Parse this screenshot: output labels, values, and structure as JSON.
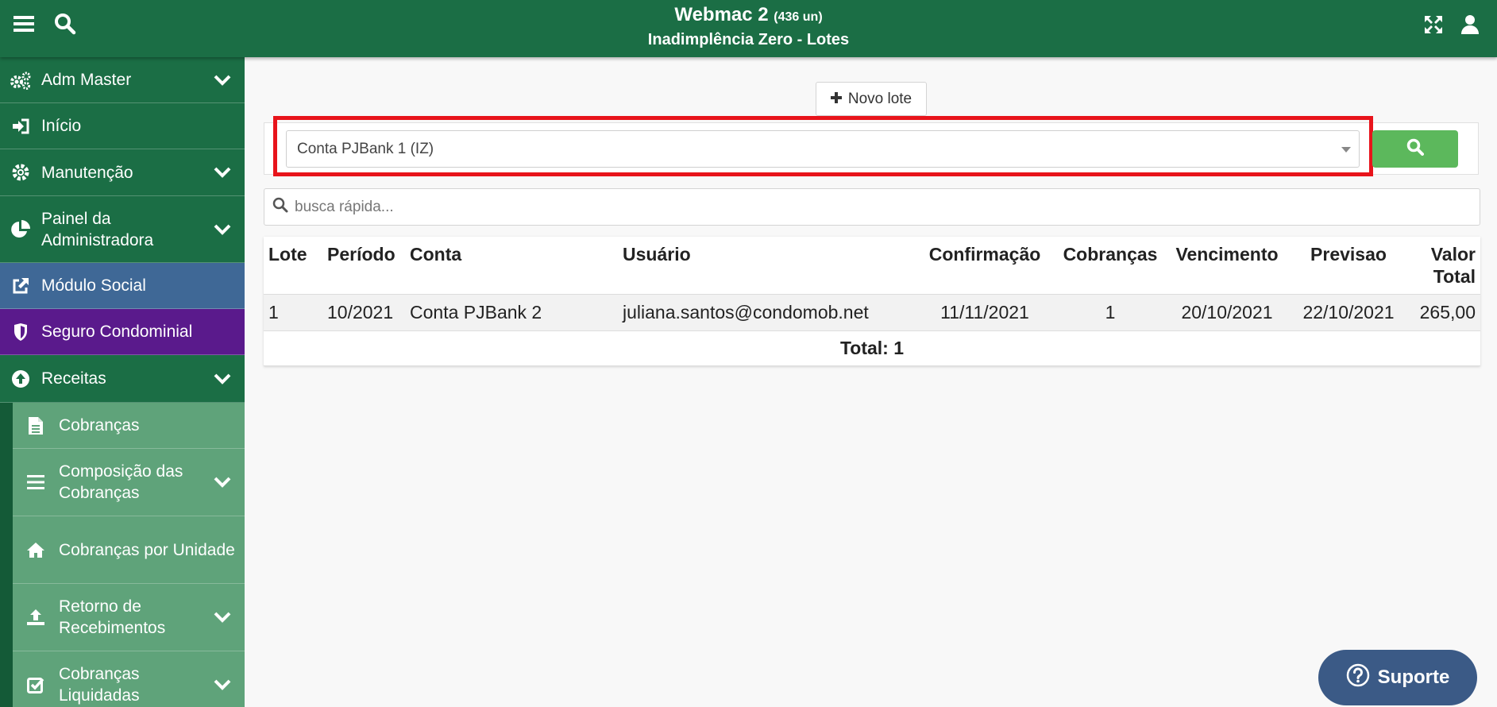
{
  "header": {
    "app_name": "Webmac 2",
    "units": "(436 un)",
    "subtitle": "Inadimplência Zero - Lotes"
  },
  "sidebar": {
    "items": [
      {
        "label": "Adm Master",
        "icon": "gears-icon"
      },
      {
        "label": "Início",
        "icon": "sign-in-icon"
      },
      {
        "label": "Manutenção",
        "icon": "gear-icon"
      },
      {
        "label": "Painel da Administradora",
        "icon": "pie-chart-icon"
      },
      {
        "label": "Módulo Social",
        "icon": "external-link-icon"
      },
      {
        "label": "Seguro Condominial",
        "icon": "shield-icon"
      },
      {
        "label": "Receitas",
        "icon": "arrow-circle-up-icon"
      }
    ],
    "sub_items": [
      {
        "label": "Cobranças",
        "icon": "file-icon"
      },
      {
        "label": "Composição das Cobranças",
        "icon": "list-icon"
      },
      {
        "label": "Cobranças por Unidade",
        "icon": "home-icon"
      },
      {
        "label": "Retorno de Recebimentos",
        "icon": "upload-icon"
      },
      {
        "label": "Cobranças Liquidadas",
        "icon": "check-square-icon"
      }
    ]
  },
  "main": {
    "novo_lote_label": "Novo lote",
    "account_select_value": "Conta PJBank 1 (IZ)",
    "quick_search_placeholder": "busca rápida..."
  },
  "table": {
    "headers": [
      "Lote",
      "Período",
      "Conta",
      "Usuário",
      "Confirmação",
      "Cobranças",
      "Vencimento",
      "Previsao",
      "Valor Total"
    ],
    "rows": [
      [
        "1",
        "10/2021",
        "Conta PJBank 2",
        "juliana.santos@condomob.net",
        "11/11/2021",
        "1",
        "20/10/2021",
        "22/10/2021",
        "265,00"
      ]
    ],
    "total_label": "Total: 1"
  },
  "support_label": "Suporte",
  "colors": {
    "primary_green": "#1b6e45",
    "social_blue": "#3f6896",
    "seguro_purple": "#5a1a8c",
    "highlight_red": "#e8141b",
    "search_green": "#5cb85c",
    "support_blue": "#3b5a86"
  }
}
